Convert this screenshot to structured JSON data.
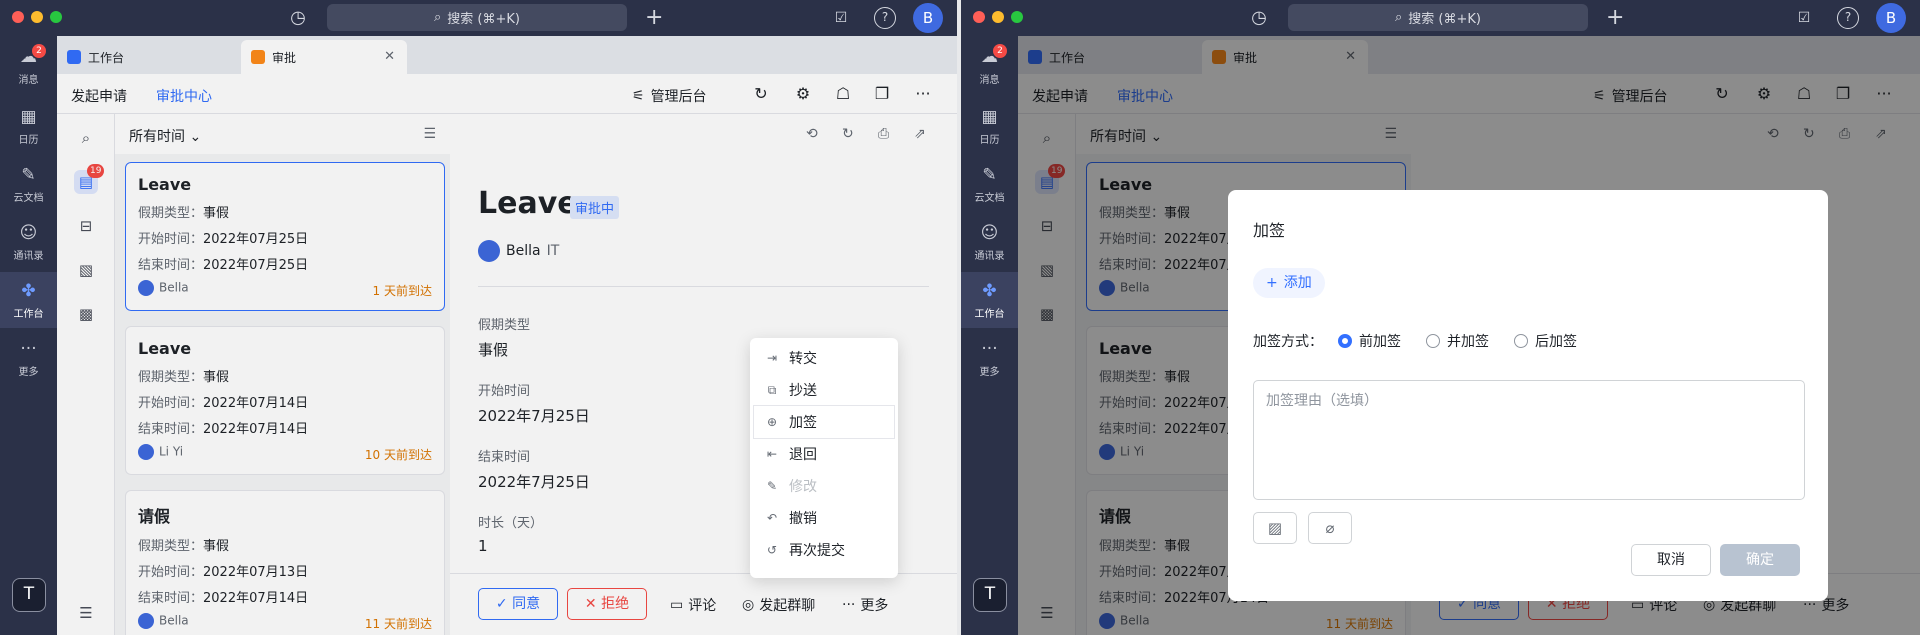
{
  "search": "搜索 (⌘+K)",
  "nav": {
    "messages": "消息",
    "messages_badge": "2",
    "calendar": "日历",
    "docs": "云文档",
    "contacts": "通讯录",
    "workplace": "工作台",
    "more": "更多",
    "workspace_letter": "T",
    "avatar_letter": "B"
  },
  "tabs": {
    "workbench": "工作台",
    "approval": "审批"
  },
  "appbar": {
    "initiate": "发起申请",
    "center": "审批中心",
    "admin": "管理后台"
  },
  "sidetools": {
    "inbox_badge": "19"
  },
  "list": {
    "filter": "所有时间",
    "cards": [
      {
        "title": "Leave",
        "type_label": "假期类型：",
        "type": "事假",
        "start_label": "开始时间：",
        "start": "2022年07月25日",
        "end_label": "结束时间：",
        "end": "2022年07月25日",
        "user": "Bella",
        "when": "1 天前到达"
      },
      {
        "title": "Leave",
        "type_label": "假期类型：",
        "type": "事假",
        "start_label": "开始时间：",
        "start": "2022年07月14日",
        "end_label": "结束时间：",
        "end": "2022年07月14日",
        "user": "Li Yi",
        "when": "10 天前到达"
      },
      {
        "title": "请假",
        "type_label": "假期类型：",
        "type": "事假",
        "start_label": "开始时间：",
        "start": "2022年07月13日",
        "end_label": "结束时间：",
        "end": "2022年07月14日",
        "user": "Bella",
        "when": "11 天前到达"
      }
    ]
  },
  "detail": {
    "title": "Leave",
    "status": "审批中",
    "applicant": "Bella",
    "dept": "IT",
    "fields": [
      {
        "label": "假期类型",
        "value": "事假"
      },
      {
        "label": "开始时间",
        "value": "2022年7月25日"
      },
      {
        "label": "结束时间",
        "value": "2022年7月25日"
      },
      {
        "label": "时长（天）",
        "value": "1"
      }
    ],
    "agree": "同意",
    "reject": "拒绝",
    "comment": "评论",
    "group_chat": "发起群聊",
    "more": "更多"
  },
  "menu": {
    "items": [
      "转交",
      "抄送",
      "加签",
      "退回",
      "修改",
      "撤销",
      "再次提交"
    ]
  },
  "modal": {
    "title": "加签",
    "add": "添加",
    "mode_label": "加签方式：",
    "opt_before": "前加签",
    "opt_parallel": "并加签",
    "opt_after": "后加签",
    "reason_placeholder": "加签理由（选填）",
    "cancel": "取消",
    "ok": "确定"
  },
  "colors": {
    "accent": "#3370ff",
    "danger": "#f54a45",
    "warning": "#de7802",
    "sidebar": "#2b3148"
  }
}
